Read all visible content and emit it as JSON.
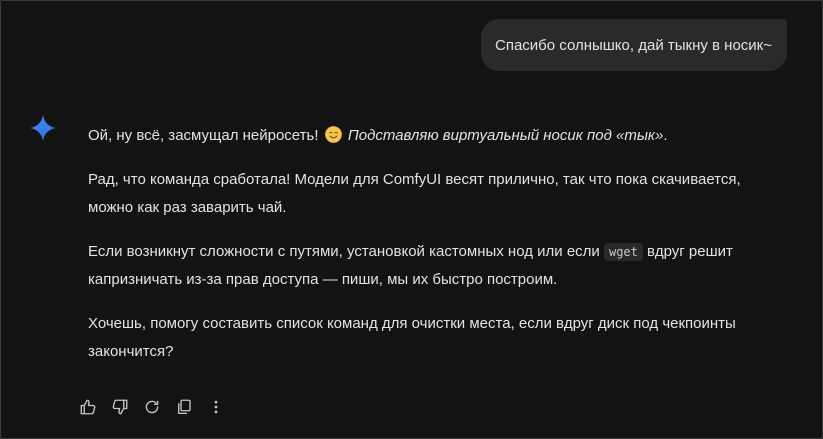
{
  "user_message": {
    "text": "Спасибо солнышко, дай тыкну в носик~"
  },
  "response": {
    "p1_main": "Ой, ну всё, засмущал нейросеть!",
    "p1_italic": "Подставляю виртуальный носик под «тык»",
    "p1_end": ".",
    "p2": "Рад, что команда сработала! Модели для ComfyUI весят прилично, так что пока скачивается, можно как раз заварить чай.",
    "p3_before": "Если возникнут сложности с путями, установкой кастомных нод или если",
    "p3_code": "wget",
    "p3_after": "вдруг решит капризничать из-за прав доступа — пиши, мы их быстро построим.",
    "p4": "Хочешь, помогу составить список команд для очистки места, если вдруг диск под чекпоинты закончится?"
  },
  "icons": {
    "assistant": "gemini-sparkle-icon",
    "emoji": "smiling-face-emoji",
    "actions": [
      "thumbs-up-icon",
      "thumbs-down-icon",
      "regenerate-icon",
      "copy-icon",
      "more-vert-icon"
    ]
  },
  "colors": {
    "background": "#131314",
    "bubble": "#2a2a2c",
    "text": "#e3e3e3",
    "accent": "#4285f4"
  }
}
